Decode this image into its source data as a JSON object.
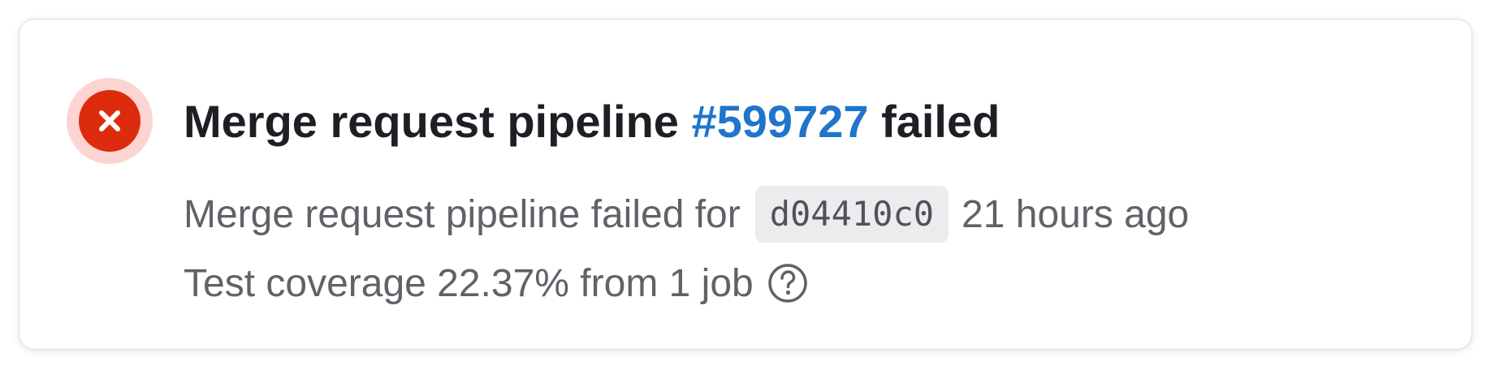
{
  "pipeline": {
    "status_icon": "status-failed-icon",
    "status_color": "#dd2b0e",
    "title_prefix": "Merge request pipeline ",
    "pipeline_id": "#599727",
    "title_suffix": " failed",
    "description": "Merge request pipeline failed for",
    "commit_sha": "d04410c0",
    "time_ago": "21 hours ago",
    "coverage_text": "Test coverage 22.37% from 1 job",
    "help_icon": "question-circle-icon",
    "link_color": "#1f75cb"
  }
}
